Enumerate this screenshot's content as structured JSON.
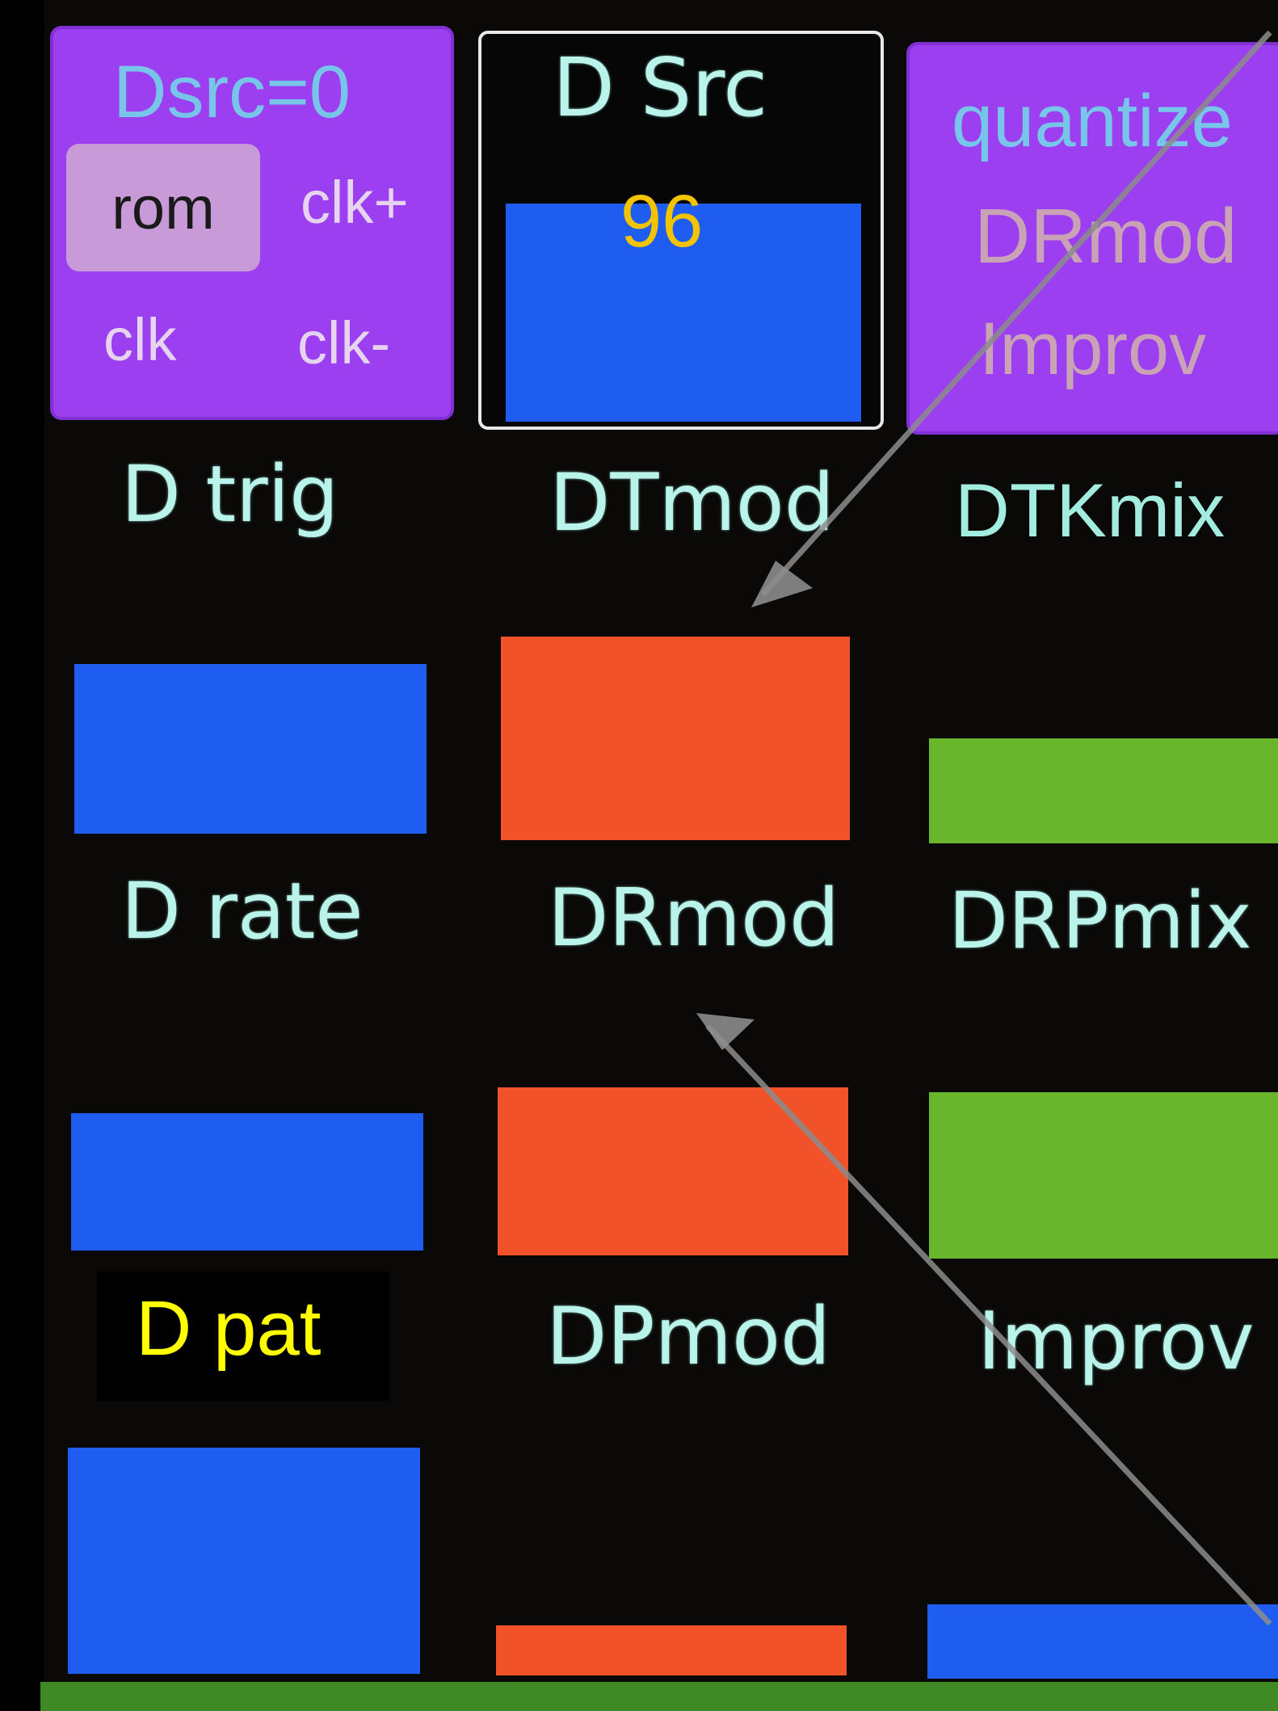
{
  "source_panel": {
    "title": "Dsrc=0",
    "options": [
      {
        "label": "rom",
        "selected": true
      },
      {
        "label": "clk+",
        "selected": false
      },
      {
        "label": "clk",
        "selected": false
      },
      {
        "label": "clk-",
        "selected": false
      }
    ]
  },
  "dsrc_param": {
    "label": "D Src",
    "value": "96",
    "level": 0.55
  },
  "mod_panel": {
    "lines": [
      "quantize",
      "DRmod",
      "Improv"
    ]
  },
  "params": [
    {
      "label": "D trig",
      "level": 0.45
    },
    {
      "label": "DTmod",
      "level": 0.7
    },
    {
      "label": "DTKmix",
      "level": 0.38
    },
    {
      "label": "D rate",
      "level": 0.48
    },
    {
      "label": "DRmod",
      "level": 0.6
    },
    {
      "label": "DRPmix",
      "level": 0.6
    },
    {
      "label": "D pat",
      "level": 0.88
    },
    {
      "label": "DPmod",
      "level": 0.18
    },
    {
      "label": "Improv",
      "level": 0.25
    }
  ],
  "colors": {
    "panel": "#9b3ff0",
    "blue": "#1f5cf0",
    "orange": "#f1522a",
    "green": "#69b52c",
    "lcd_text": "#b9f3ea",
    "value_text": "#f2c400",
    "highlight_text": "#ffff00"
  }
}
